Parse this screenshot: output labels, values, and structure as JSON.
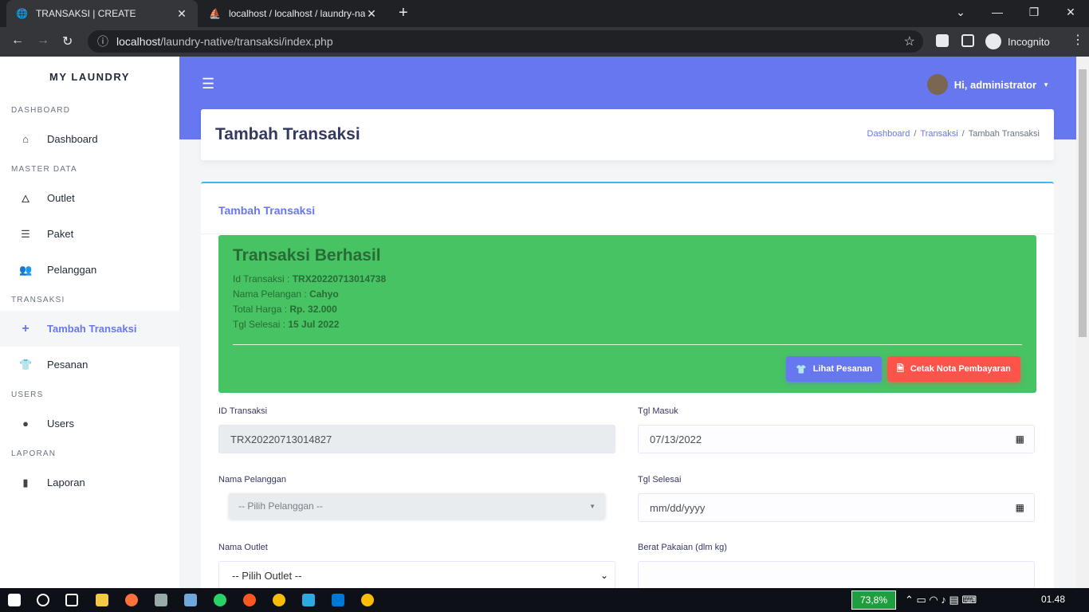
{
  "browser": {
    "tabs": [
      {
        "title": "TRANSAKSI | CREATE",
        "active": true
      },
      {
        "title": "localhost / localhost / laundry-na",
        "active": false
      }
    ],
    "url_host": "localhost",
    "url_path": "/laundry-native/transaksi/index.php",
    "profile": "Incognito",
    "new_tab": "+"
  },
  "sidebar": {
    "brand": "MY LAUNDRY",
    "sections": [
      {
        "title": "DASHBOARD",
        "items": [
          {
            "label": "Dashboard",
            "icon": "home-icon"
          }
        ]
      },
      {
        "title": "MASTER DATA",
        "items": [
          {
            "label": "Outlet",
            "icon": "fire-icon"
          },
          {
            "label": "Paket",
            "icon": "list-icon"
          },
          {
            "label": "Pelanggan",
            "icon": "users-icon"
          }
        ]
      },
      {
        "title": "TRANSAKSI",
        "items": [
          {
            "label": "Tambah Transaksi",
            "icon": "plus-icon",
            "active": true
          },
          {
            "label": "Pesanan",
            "icon": "tshirt-icon"
          }
        ]
      },
      {
        "title": "USERS",
        "items": [
          {
            "label": "Users",
            "icon": "user-icon"
          }
        ]
      },
      {
        "title": "LAPORAN",
        "items": [
          {
            "label": "Laporan",
            "icon": "file-icon"
          }
        ]
      }
    ]
  },
  "topbar": {
    "user_greeting": "Hi, administrator"
  },
  "header": {
    "title": "Tambah Transaksi",
    "breadcrumb": [
      "Dashboard",
      "Transaksi",
      "Tambah Transaksi"
    ]
  },
  "card": {
    "title": "Tambah Transaksi"
  },
  "alert": {
    "title": "Transaksi Berhasil",
    "rows": [
      {
        "label": "Id Transaksi : ",
        "value": "TRX20220713014738"
      },
      {
        "label": "Nama Pelangan : ",
        "value": "Cahyo"
      },
      {
        "label": "Total Harga : ",
        "value": "Rp. 32.000"
      },
      {
        "label": "Tgl Selesai : ",
        "value": "15 Jul 2022"
      }
    ],
    "btn_view": "Lihat Pesanan",
    "btn_print": "Cetak Nota Pembayaran"
  },
  "form": {
    "id_label": "ID Transaksi",
    "id_value": "TRX20220713014827",
    "tgl_masuk_label": "Tgl Masuk",
    "tgl_masuk_value": "07/13/2022",
    "pelanggan_label": "Nama Pelanggan",
    "pelanggan_placeholder": "-- Pilih Pelanggan --",
    "tgl_selesai_label": "Tgl Selesai",
    "tgl_selesai_placeholder": "mm/dd/yyyy",
    "outlet_label": "Nama Outlet",
    "outlet_selected": "-- Pilih Outlet --",
    "berat_label": "Berat Pakaian (dlm kg)",
    "berat_value": ""
  },
  "taskbar": {
    "battery": "73,8%",
    "time": "01.48"
  },
  "colors": {
    "primary": "#6777ef",
    "success": "#47c363",
    "danger": "#fc544b"
  }
}
